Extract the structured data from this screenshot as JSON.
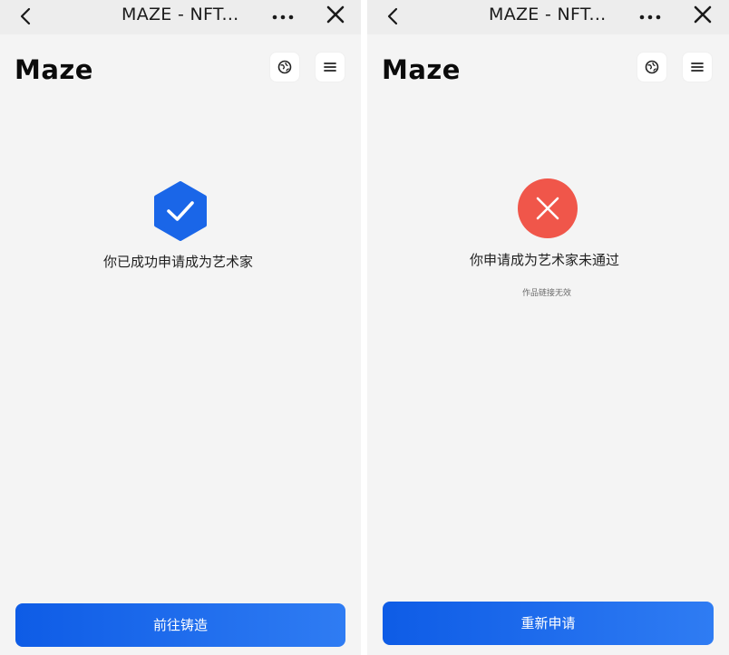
{
  "screens": [
    {
      "window_title": "MAZE - NFT...",
      "logo": "Maze",
      "icons": {
        "back": "chevron-left-icon",
        "more": "more-horizontal-icon",
        "close": "close-icon",
        "language": "globe-icon",
        "menu": "menu-icon",
        "status": "hexagon-check-icon"
      },
      "message": "你已成功申请成为艺术家",
      "button_label": "前往铸造"
    },
    {
      "window_title": "MAZE - NFT...",
      "logo": "Maze",
      "icons": {
        "back": "chevron-left-icon",
        "more": "more-horizontal-icon",
        "close": "close-icon",
        "language": "globe-icon",
        "menu": "menu-icon",
        "status": "circle-x-icon"
      },
      "message": "你申请成为艺术家未通过",
      "sub_message": "作品链接无效",
      "button_label": "重新申请"
    }
  ],
  "colors": {
    "primary": "#1a66ea",
    "success_icon": "#1a66e8",
    "error_icon": "#f0564a",
    "background": "#f4f4f4",
    "topbar": "#ededed"
  }
}
